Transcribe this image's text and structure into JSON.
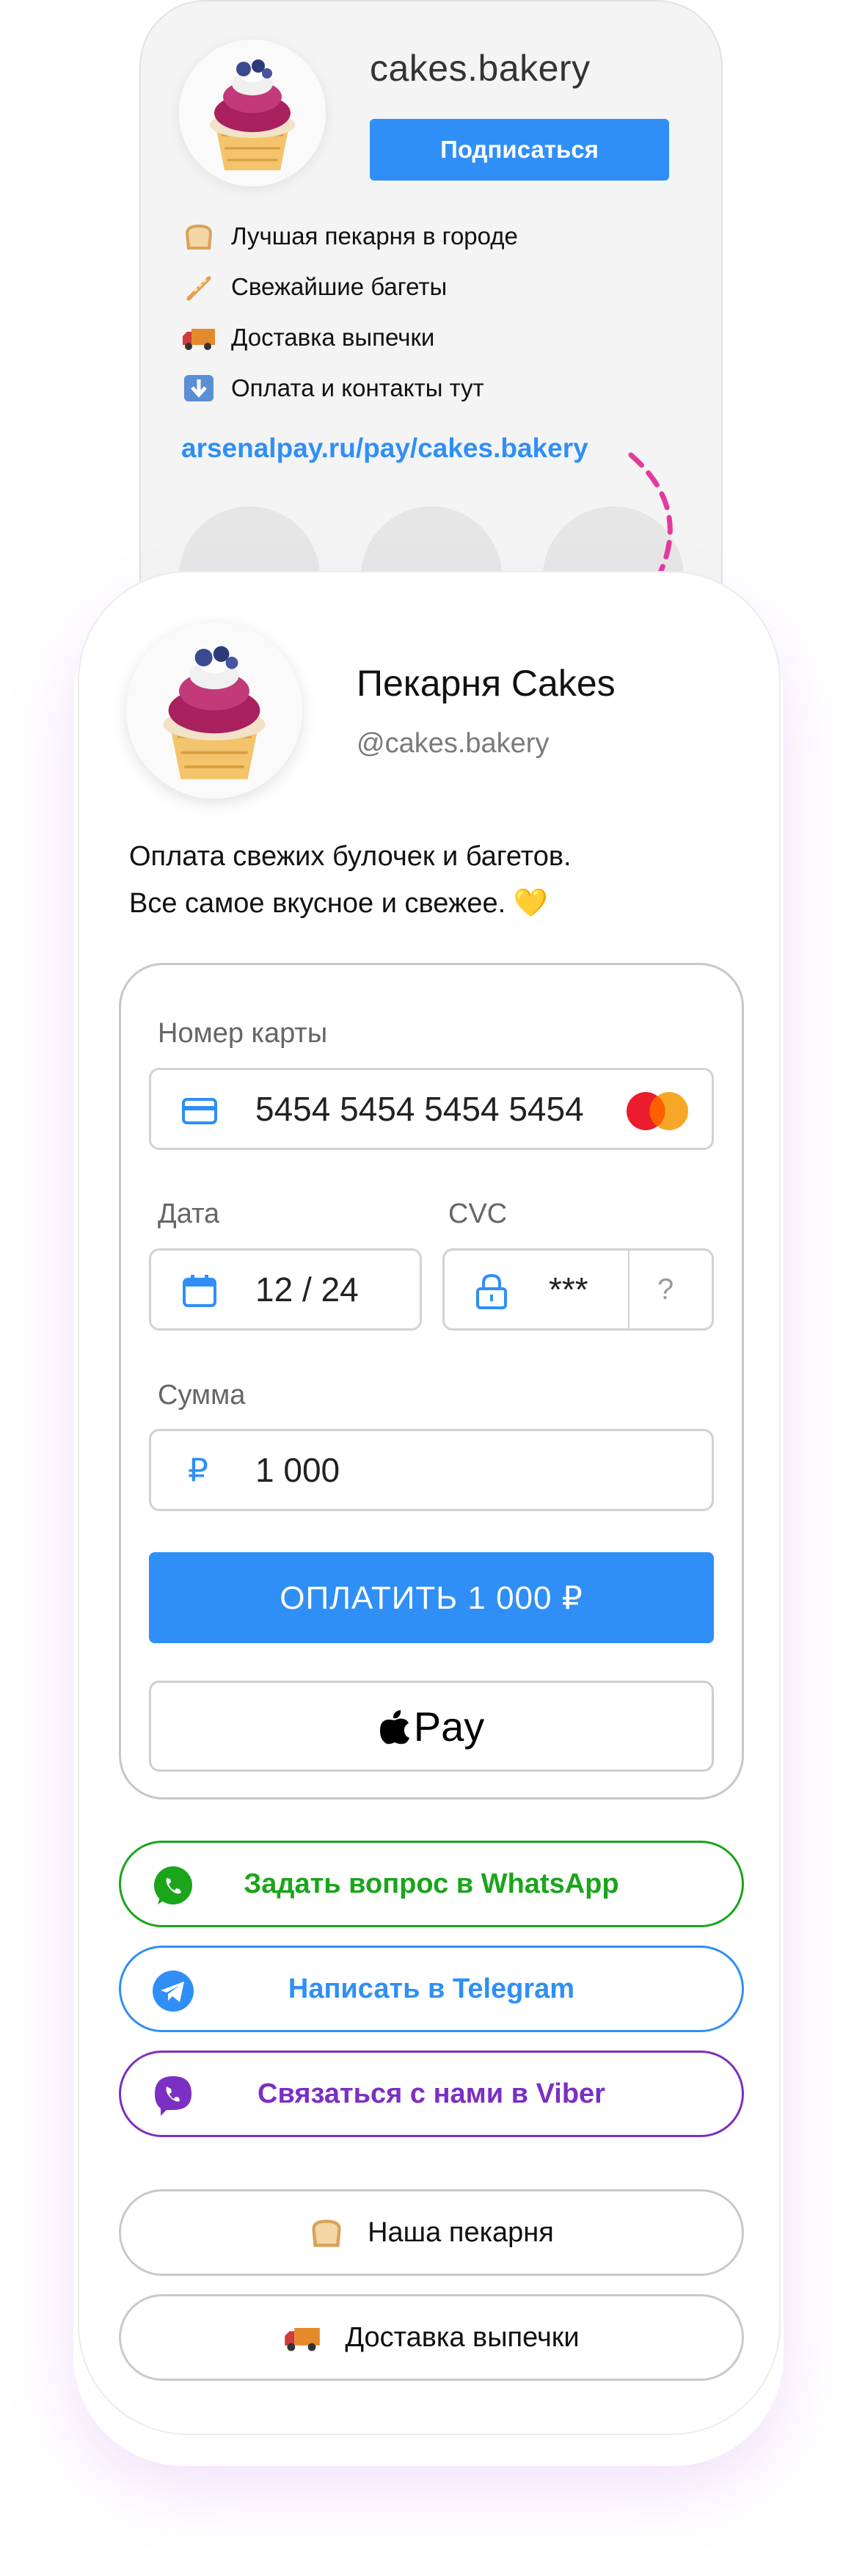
{
  "profile_preview": {
    "username": "cakes.bakery",
    "subscribe_label": "Подписаться",
    "bio": [
      {
        "icon": "bread-emoji",
        "text": "Лучшая пекарня в городе"
      },
      {
        "icon": "baguette-emoji",
        "text": "Свежайшие багеты"
      },
      {
        "icon": "truck-emoji",
        "text": "Доставка выпечки"
      },
      {
        "icon": "down-arrow-emoji",
        "text": "Оплата и контакты тут"
      }
    ],
    "link": "arsenalpay.ru/pay/cakes.bakery"
  },
  "page": {
    "name": "Пекарня Cakes",
    "handle": "@cakes.bakery",
    "description_line1": "Оплата свежих булочек и багетов.",
    "description_line2": "Все самое вкусное и свежее. 💛"
  },
  "form": {
    "card_label": "Номер карты",
    "card_number": "5454 5454 5454 5454",
    "date_label": "Дата",
    "date_value": "12 / 24",
    "cvc_label": "CVC",
    "cvc_value": "***",
    "cvc_help": "?",
    "amount_label": "Сумма",
    "currency_symbol": "₽",
    "amount_value": "1 000",
    "pay_label": "ОПЛАТИТЬ 1 000 ₽",
    "apple_pay_label": "Pay"
  },
  "messengers": {
    "whatsapp": "Задать вопрос в WhatsApp",
    "telegram": "Написать в Telegram",
    "viber": "Связаться с нами в Viber"
  },
  "links": {
    "bakery": "Наша пекарня",
    "delivery": "Доставка выпечки"
  },
  "colors": {
    "accent": "#2f8ff6",
    "whatsapp": "#1aa51a",
    "telegram": "#2f8ff6",
    "viber": "#7b2fc3"
  }
}
